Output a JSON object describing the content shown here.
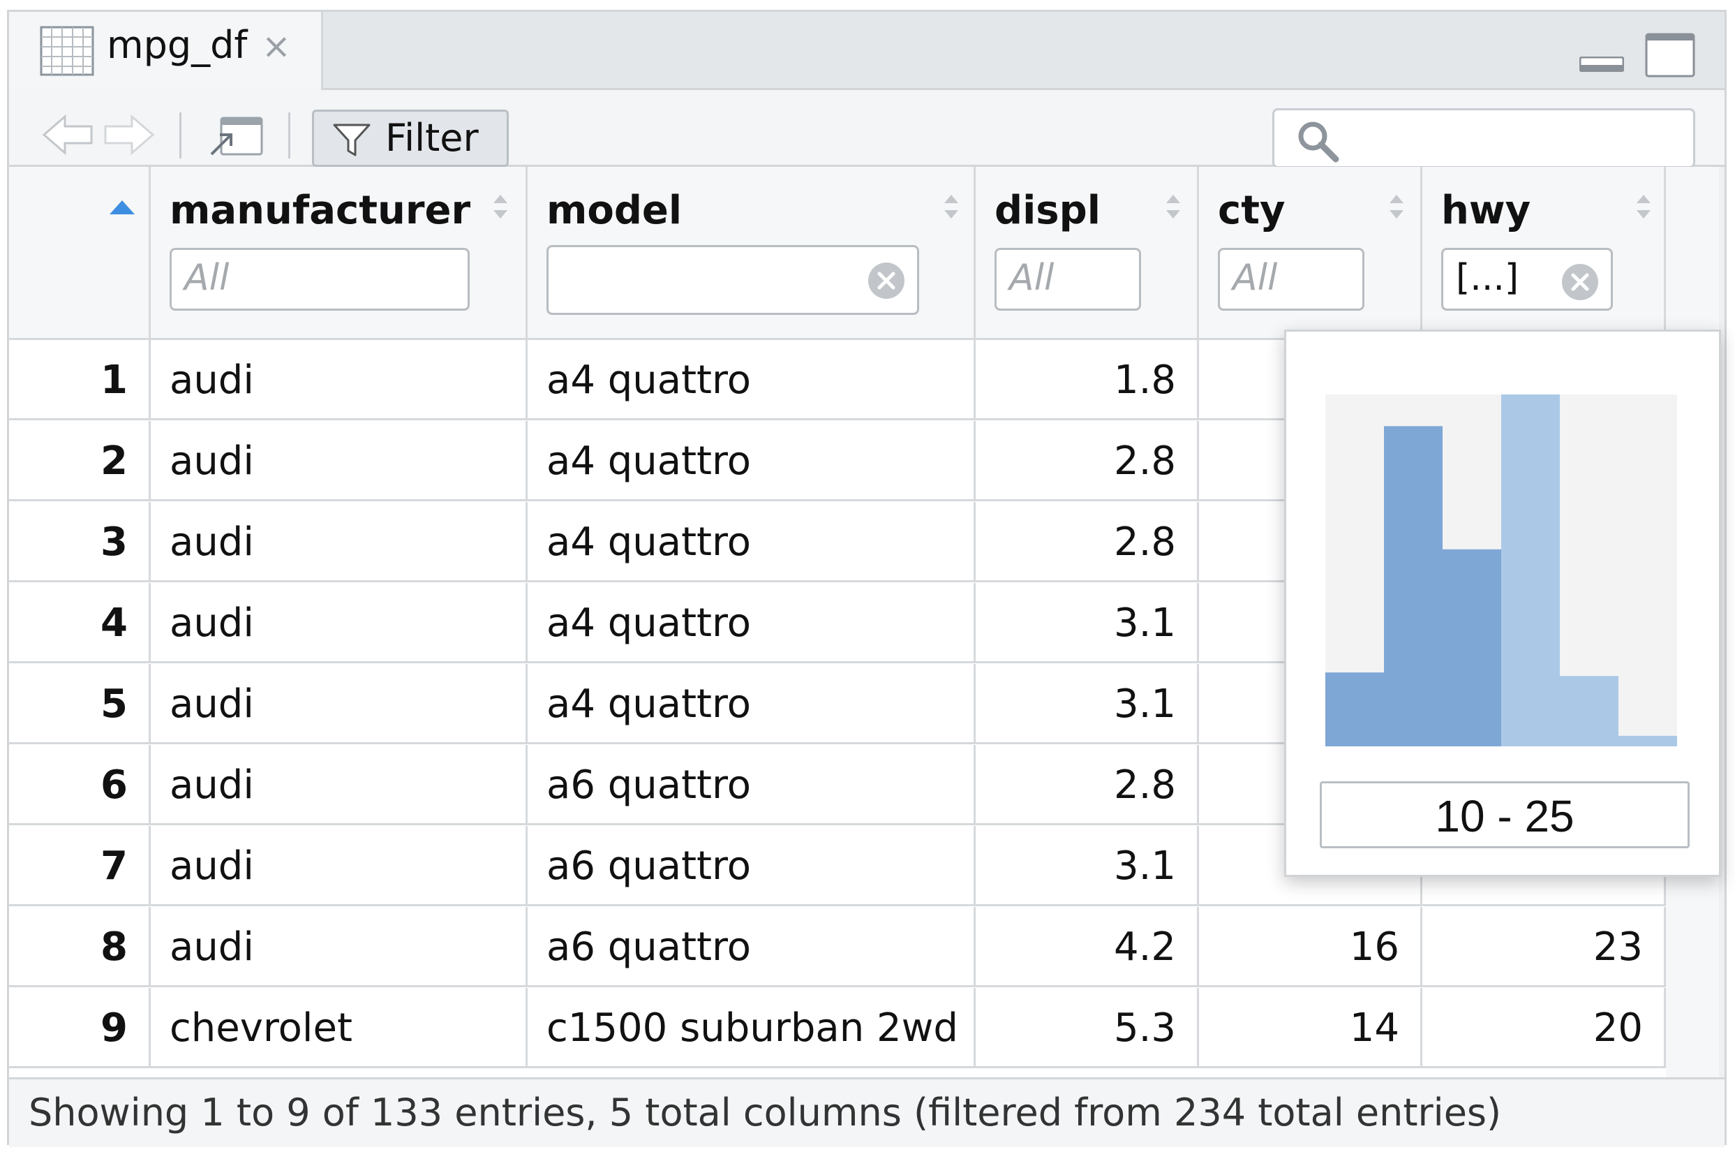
{
  "tab": {
    "title": "mpg_df",
    "close": "×"
  },
  "toolbar": {
    "filter_label": "Filter",
    "search_placeholder": ""
  },
  "columns": [
    {
      "name": "manufacturer",
      "filter_placeholder": "All",
      "filter_value": ""
    },
    {
      "name": "model",
      "filter_placeholder": "",
      "filter_value": ""
    },
    {
      "name": "displ",
      "filter_placeholder": "All",
      "filter_value": ""
    },
    {
      "name": "cty",
      "filter_placeholder": "All",
      "filter_value": ""
    },
    {
      "name": "hwy",
      "filter_placeholder": "",
      "filter_value": "[...]"
    }
  ],
  "rows": [
    {
      "idx": "1",
      "manufacturer": "audi",
      "model": "a4 quattro",
      "displ": "1.8",
      "cty": "",
      "hwy": ""
    },
    {
      "idx": "2",
      "manufacturer": "audi",
      "model": "a4 quattro",
      "displ": "2.8",
      "cty": "",
      "hwy": ""
    },
    {
      "idx": "3",
      "manufacturer": "audi",
      "model": "a4 quattro",
      "displ": "2.8",
      "cty": "",
      "hwy": ""
    },
    {
      "idx": "4",
      "manufacturer": "audi",
      "model": "a4 quattro",
      "displ": "3.1",
      "cty": "",
      "hwy": ""
    },
    {
      "idx": "5",
      "manufacturer": "audi",
      "model": "a4 quattro",
      "displ": "3.1",
      "cty": "",
      "hwy": ""
    },
    {
      "idx": "6",
      "manufacturer": "audi",
      "model": "a6 quattro",
      "displ": "2.8",
      "cty": "",
      "hwy": ""
    },
    {
      "idx": "7",
      "manufacturer": "audi",
      "model": "a6 quattro",
      "displ": "3.1",
      "cty": "",
      "hwy": ""
    },
    {
      "idx": "8",
      "manufacturer": "audi",
      "model": "a6 quattro",
      "displ": "4.2",
      "cty": "16",
      "hwy": "23"
    },
    {
      "idx": "9",
      "manufacturer": "chevrolet",
      "model": "c1500 suburban 2wd",
      "displ": "5.3",
      "cty": "14",
      "hwy": "20"
    }
  ],
  "status": {
    "text": "Showing 1 to 9 of 133 entries, 5 total columns (filtered from 234 total entries)"
  },
  "popup": {
    "range_label": "10 - 25",
    "histogram": {
      "bins": [
        0.21,
        0.91,
        0.56,
        1.0,
        0.2,
        0.03
      ],
      "selected": [
        true,
        true,
        true,
        false,
        false,
        false
      ],
      "max_level": 1.0
    }
  },
  "colors": {
    "selected_bar": "#7fa7d6",
    "unselected_bar": "#abc9e6",
    "hist_bg": "#f3f3f3",
    "sort_active": "#3d8ee0"
  }
}
